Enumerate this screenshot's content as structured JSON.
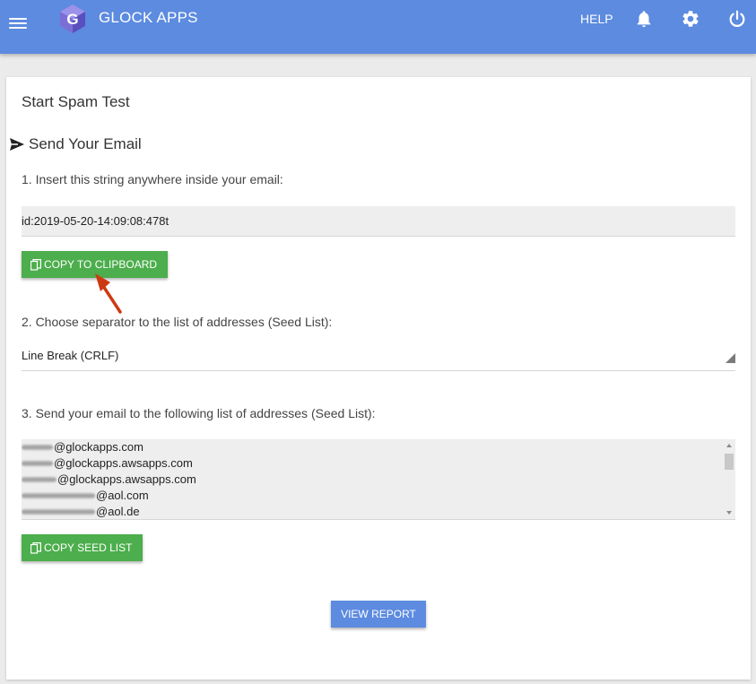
{
  "header": {
    "app_title": "GLOCK APPS",
    "help_label": "HELP",
    "logo_letter": "G",
    "icons": [
      "menu-icon",
      "bell-icon",
      "gear-icon",
      "power-icon"
    ],
    "brand_color": "#5c8be0"
  },
  "card": {
    "title": "Start Spam Test",
    "section_title": "Send Your Email",
    "step1": "1. Insert this string anywhere inside your email:",
    "test_id": "id:2019-05-20-14:09:08:478t",
    "copy_clipboard_label": "COPY TO CLIPBOARD",
    "step2": "2. Choose separator to the list of addresses (Seed List):",
    "separator_value": "Line Break (CRLF)",
    "step3": "3. Send your email to the following list of addresses (Seed List):",
    "seed_list": [
      "@glockapps.com",
      "@glockapps.awsapps.com",
      "@glockapps.awsapps.com",
      "@aol.com",
      "@aol.de"
    ],
    "copy_seed_label": "COPY SEED LIST",
    "view_report_label": "VIEW REPORT",
    "button_green": "#4cae4c",
    "annotation_arrow_color": "#cc3a12"
  }
}
